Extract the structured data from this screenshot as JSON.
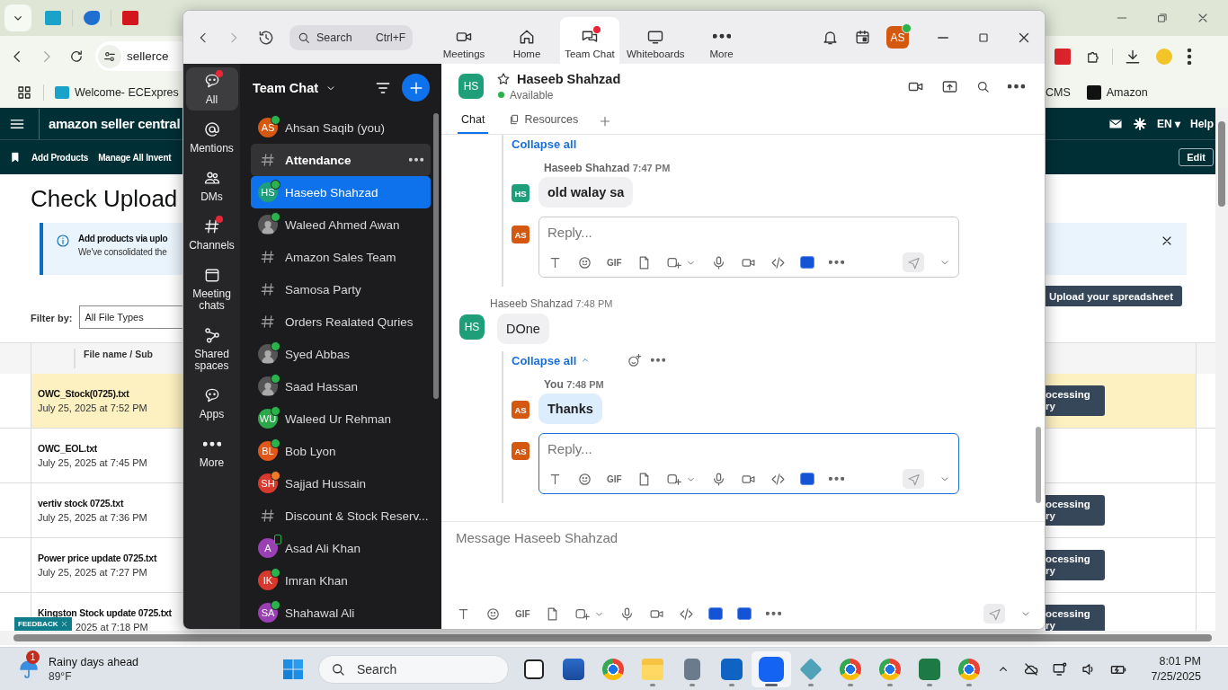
{
  "browser": {
    "address": {
      "url": "sellerce"
    },
    "bookmarks": [
      {
        "label": "Welcome- ECExpres"
      },
      {
        "label": "CMS"
      },
      {
        "label": "Amazon"
      }
    ],
    "seller_header": {
      "logo": "amazon seller central",
      "language": "EN ▾",
      "help": "Help"
    },
    "nav": {
      "links": [
        "Add Products",
        "Manage All Invent"
      ],
      "edit": "Edit"
    },
    "page": {
      "title": "Check Upload",
      "banner": {
        "title": "Add products via uplo",
        "text": "We've consolidated the"
      },
      "upload_button": "Upload your spreadsheet",
      "filter": {
        "label": "Filter by:",
        "value": "All File Types"
      },
      "table": {
        "column": "File name / Sub",
        "rows": [
          {
            "file": "OWC_Stock(0725).txt",
            "date": "July 25, 2025 at 7:52 PM",
            "selected": true,
            "action": [
              "ocessing",
              "ry"
            ]
          },
          {
            "file": "OWC_EOL.txt",
            "date": "July 25, 2025 at 7:45 PM",
            "selected": false
          },
          {
            "file": "vertiv stock 0725.txt",
            "date": "July 25, 2025 at 7:36 PM",
            "selected": false,
            "action": [
              "ocessing",
              "ry"
            ]
          },
          {
            "file": "Power price update 0725.txt",
            "date": "July 25, 2025 at 7:27 PM",
            "selected": false,
            "action": [
              "ocessing",
              "ry"
            ]
          },
          {
            "file": "Kingston Stock update 0725.txt",
            "date": "2025 at 7:18 PM",
            "selected": false,
            "action": [
              "ocessing",
              "ry"
            ]
          }
        ]
      }
    },
    "feedback": "FEEDBACK"
  },
  "zoom": {
    "search": {
      "placeholder": "Search",
      "shortcut": "Ctrl+F"
    },
    "tabs": [
      {
        "label": "Meetings",
        "selected": false,
        "badge": false
      },
      {
        "label": "Home",
        "selected": false,
        "badge": false
      },
      {
        "label": "Team Chat",
        "selected": true,
        "badge": true
      },
      {
        "label": "Whiteboards",
        "selected": false,
        "badge": false
      },
      {
        "label": "More",
        "selected": false,
        "badge": false
      }
    ],
    "account": {
      "initials": "AS",
      "color": "#d4580f",
      "online": true
    },
    "rail": [
      {
        "label": "All",
        "selected": true,
        "badge": true
      },
      {
        "label": "Mentions",
        "selected": false,
        "badge": false
      },
      {
        "label": "DMs",
        "selected": false,
        "badge": false
      },
      {
        "label": "Channels",
        "selected": false,
        "badge": true
      },
      {
        "label": "Meeting chats",
        "selected": false,
        "badge": false
      },
      {
        "label": "Shared spaces",
        "selected": false,
        "badge": false
      },
      {
        "label": "Apps",
        "selected": false,
        "badge": false
      },
      {
        "label": "More",
        "selected": false,
        "badge": false
      }
    ],
    "list_title": "Team Chat",
    "chats": [
      {
        "kind": "person",
        "initials": "AS",
        "color": "#d4580f",
        "name": "Ahsan Saqib (you)",
        "online": true,
        "away": false,
        "mobile": false,
        "selected": false,
        "unread": false,
        "highlighted": false
      },
      {
        "kind": "channel",
        "name": "Attendance",
        "online": false,
        "away": false,
        "mobile": false,
        "selected": false,
        "unread": true,
        "highlighted": true
      },
      {
        "kind": "person",
        "initials": "HS",
        "color": "#1e9e79",
        "name": "Haseeb Shahzad",
        "online": true,
        "away": false,
        "mobile": false,
        "selected": true,
        "unread": false,
        "highlighted": false
      },
      {
        "kind": "photo",
        "name": "Waleed Ahmed Awan",
        "online": true,
        "away": false,
        "mobile": false,
        "selected": false,
        "unread": false,
        "highlighted": false
      },
      {
        "kind": "channel",
        "name": "Amazon Sales Team",
        "online": false,
        "away": false,
        "mobile": false,
        "selected": false,
        "unread": false,
        "highlighted": false
      },
      {
        "kind": "channel",
        "name": "Samosa Party",
        "online": false,
        "away": false,
        "mobile": false,
        "selected": false,
        "unread": false,
        "highlighted": false
      },
      {
        "kind": "channel",
        "name": "Orders Realated Quries",
        "online": false,
        "away": false,
        "mobile": false,
        "selected": false,
        "unread": false,
        "highlighted": false
      },
      {
        "kind": "photo",
        "name": "Syed Abbas",
        "online": true,
        "away": false,
        "mobile": false,
        "selected": false,
        "unread": false,
        "highlighted": false
      },
      {
        "kind": "photo",
        "name": "Saad Hassan",
        "online": true,
        "away": false,
        "mobile": false,
        "selected": false,
        "unread": false,
        "highlighted": false
      },
      {
        "kind": "person",
        "initials": "WU",
        "color": "#2aa84a",
        "name": "Waleed Ur Rehman",
        "online": true,
        "away": false,
        "mobile": false,
        "selected": false,
        "unread": false,
        "highlighted": false
      },
      {
        "kind": "person",
        "initials": "BL",
        "color": "#e0571a",
        "name": "Bob Lyon",
        "online": true,
        "away": false,
        "mobile": false,
        "selected": false,
        "unread": false,
        "highlighted": false
      },
      {
        "kind": "person",
        "initials": "SH",
        "color": "#d73a2c",
        "name": "Sajjad Hussain",
        "online": false,
        "away": true,
        "mobile": false,
        "selected": false,
        "unread": false,
        "highlighted": false
      },
      {
        "kind": "channel",
        "name": "Discount & Stock Reserv...",
        "online": false,
        "away": false,
        "mobile": false,
        "selected": false,
        "unread": false,
        "highlighted": false
      },
      {
        "kind": "person",
        "initials": "A",
        "color": "#9b3fb5",
        "name": "Asad Ali Khan",
        "online": false,
        "away": false,
        "mobile": true,
        "selected": false,
        "unread": false,
        "highlighted": false
      },
      {
        "kind": "person",
        "initials": "IK",
        "color": "#d73a2c",
        "name": "Imran Khan",
        "online": true,
        "away": false,
        "mobile": false,
        "selected": false,
        "unread": false,
        "highlighted": false
      },
      {
        "kind": "person",
        "initials": "SA",
        "color": "#9b3fb5",
        "name": "Shahawal Ali",
        "online": true,
        "away": false,
        "mobile": false,
        "selected": false,
        "unread": false,
        "highlighted": false
      }
    ],
    "conversation": {
      "initials": "HS",
      "color": "#1e9e79",
      "name": "Haseeb Shahzad",
      "status": "Available",
      "tabs": [
        {
          "label": "Chat",
          "selected": true
        },
        {
          "label": "Resources",
          "selected": false
        }
      ],
      "messages": [
        {
          "kind": "collapse",
          "label": "Collapse all",
          "actions": false
        },
        {
          "kind": "reply",
          "initials": "HS",
          "color": "#1e9e79",
          "sender": "Haseeb Shahzad",
          "time": "7:47 PM",
          "text": "old walay sa",
          "mine": false
        },
        {
          "kind": "reply_box",
          "initials": "AS",
          "color": "#d4580f",
          "placeholder": "Reply...",
          "gif": "GIF",
          "focused": false
        },
        {
          "kind": "message",
          "initials": "HS",
          "color": "#1e9e79",
          "sender": "Haseeb Shahzad",
          "time": "7:48 PM",
          "text": "DOne",
          "mine": false
        },
        {
          "kind": "collapse",
          "label": "Collapse all",
          "actions": true
        },
        {
          "kind": "reply",
          "initials": "AS",
          "color": "#d4580f",
          "sender": "You",
          "time": "7:48 PM",
          "text": "Thanks",
          "mine": true
        },
        {
          "kind": "reply_box",
          "initials": "AS",
          "color": "#d4580f",
          "placeholder": "Reply...",
          "gif": "GIF",
          "focused": true
        }
      ],
      "composer": {
        "placeholder": "Message Haseeb Shahzad",
        "gif": "GIF"
      }
    }
  },
  "taskbar": {
    "weather": {
      "badge": "1",
      "title": "Rainy days ahead",
      "temp": "89°F"
    },
    "search": {
      "placeholder": "Search"
    },
    "apps": [
      {
        "running": false,
        "active": false
      },
      {
        "running": false,
        "active": false
      },
      {
        "running": false,
        "active": false
      },
      {
        "running": true,
        "active": false
      },
      {
        "running": true,
        "active": false
      },
      {
        "running": true,
        "active": false
      },
      {
        "running": true,
        "active": true
      },
      {
        "running": true,
        "active": false
      },
      {
        "running": true,
        "active": false
      },
      {
        "running": true,
        "active": false
      },
      {
        "running": true,
        "active": false
      },
      {
        "running": true,
        "active": false
      }
    ],
    "clock": {
      "time": "8:01 PM",
      "date": "7/25/2025"
    }
  }
}
